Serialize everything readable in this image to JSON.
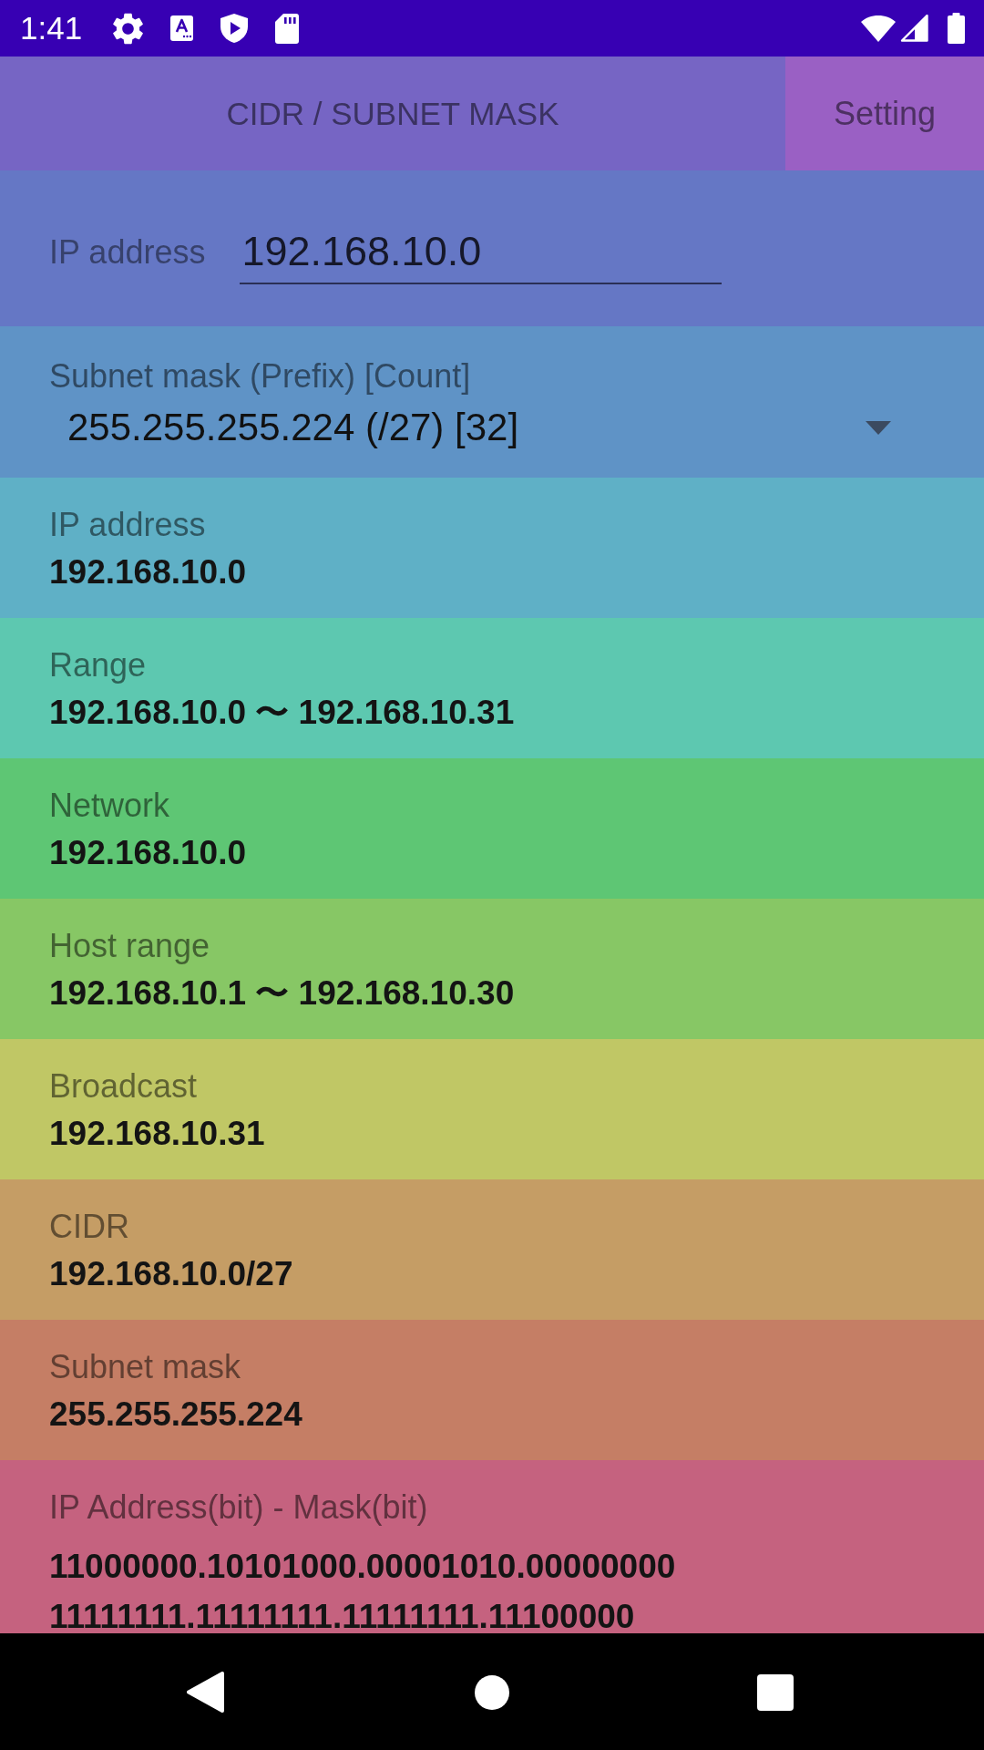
{
  "status_bar": {
    "time": "1:41"
  },
  "app_bar": {
    "title": "CIDR / SUBNET MASK",
    "setting_button": "Setting"
  },
  "ip_input": {
    "label": "IP address",
    "value": "192.168.10.0"
  },
  "subnet_select": {
    "label": "Subnet mask (Prefix) [Count]",
    "value": "255.255.255.224 (/27) [32]"
  },
  "results": [
    {
      "label": "IP address",
      "values": [
        "192.168.10.0"
      ],
      "color": "#5fb0c6"
    },
    {
      "label": "Range",
      "values": [
        "192.168.10.0 〜 192.168.10.31"
      ],
      "color": "#5dc8b0"
    },
    {
      "label": "Network",
      "values": [
        "192.168.10.0"
      ],
      "color": "#5ec674"
    },
    {
      "label": "Host range",
      "values": [
        "192.168.10.1 〜 192.168.10.30"
      ],
      "color": "#87c765"
    },
    {
      "label": "Broadcast",
      "values": [
        "192.168.10.31"
      ],
      "color": "#c0c765"
    },
    {
      "label": "CIDR",
      "values": [
        "192.168.10.0/27"
      ],
      "color": "#c59d65"
    },
    {
      "label": "Subnet mask",
      "values": [
        "255.255.255.224"
      ],
      "color": "#c57e65"
    },
    {
      "label": "IP Address(bit) - Mask(bit)",
      "values": [
        "11000000.10101000.00001010.00000000",
        "11111111.11111111.11111111.11100000"
      ],
      "color": "#c5627f"
    }
  ]
}
